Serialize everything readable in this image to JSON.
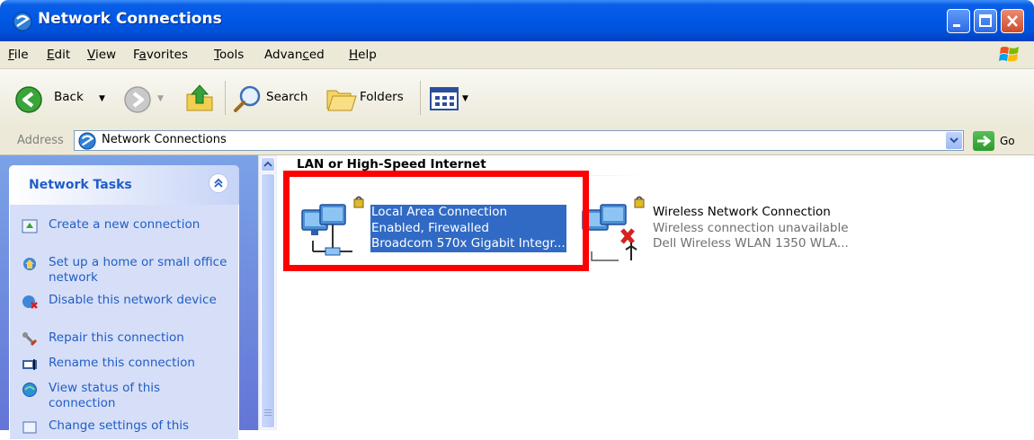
{
  "window": {
    "title": "Network Connections"
  },
  "menu": [
    {
      "label_pre": "",
      "label_u": "F",
      "label_post": "ile"
    },
    {
      "label_pre": "",
      "label_u": "E",
      "label_post": "dit"
    },
    {
      "label_pre": "",
      "label_u": "V",
      "label_post": "iew"
    },
    {
      "label_pre": "F",
      "label_u": "a",
      "label_post": "vorites"
    },
    {
      "label_pre": "",
      "label_u": "T",
      "label_post": "ools"
    },
    {
      "label_pre": "Advan",
      "label_u": "c",
      "label_post": "ed"
    },
    {
      "label_pre": "",
      "label_u": "H",
      "label_post": "elp"
    }
  ],
  "toolbar": {
    "back_label": "Back",
    "search_label": "Search",
    "folders_label": "Folders"
  },
  "address": {
    "label": "Address",
    "value": "Network Connections",
    "go_label": "Go"
  },
  "tasks": {
    "title": "Network Tasks",
    "items": [
      {
        "label": "Create a new connection",
        "icon": "new-connection-icon"
      },
      {
        "label": "Set up a home or small office network",
        "icon": "home-network-icon"
      },
      {
        "label": "Disable this network device",
        "icon": "disable-device-icon"
      },
      {
        "label": "Repair this connection",
        "icon": "repair-icon"
      },
      {
        "label": "Rename this connection",
        "icon": "rename-icon"
      },
      {
        "label": "View status of this connection",
        "icon": "view-status-icon"
      },
      {
        "label": "Change settings of this",
        "icon": "change-settings-icon"
      }
    ]
  },
  "group": {
    "title": "LAN or High-Speed Internet"
  },
  "connections": [
    {
      "name": "Local Area Connection",
      "status": "Enabled, Firewalled",
      "device": "Broadcom 570x Gigabit Integr...",
      "selected": true
    },
    {
      "name": "Wireless Network Connection",
      "status": "Wireless connection unavailable",
      "device": "Dell Wireless WLAN 1350 WLA...",
      "selected": false
    }
  ],
  "colors": {
    "title_bar": "#0058e6",
    "selection": "#316ac5",
    "task_link": "#215dc6",
    "highlight_box": "#ff0000"
  }
}
